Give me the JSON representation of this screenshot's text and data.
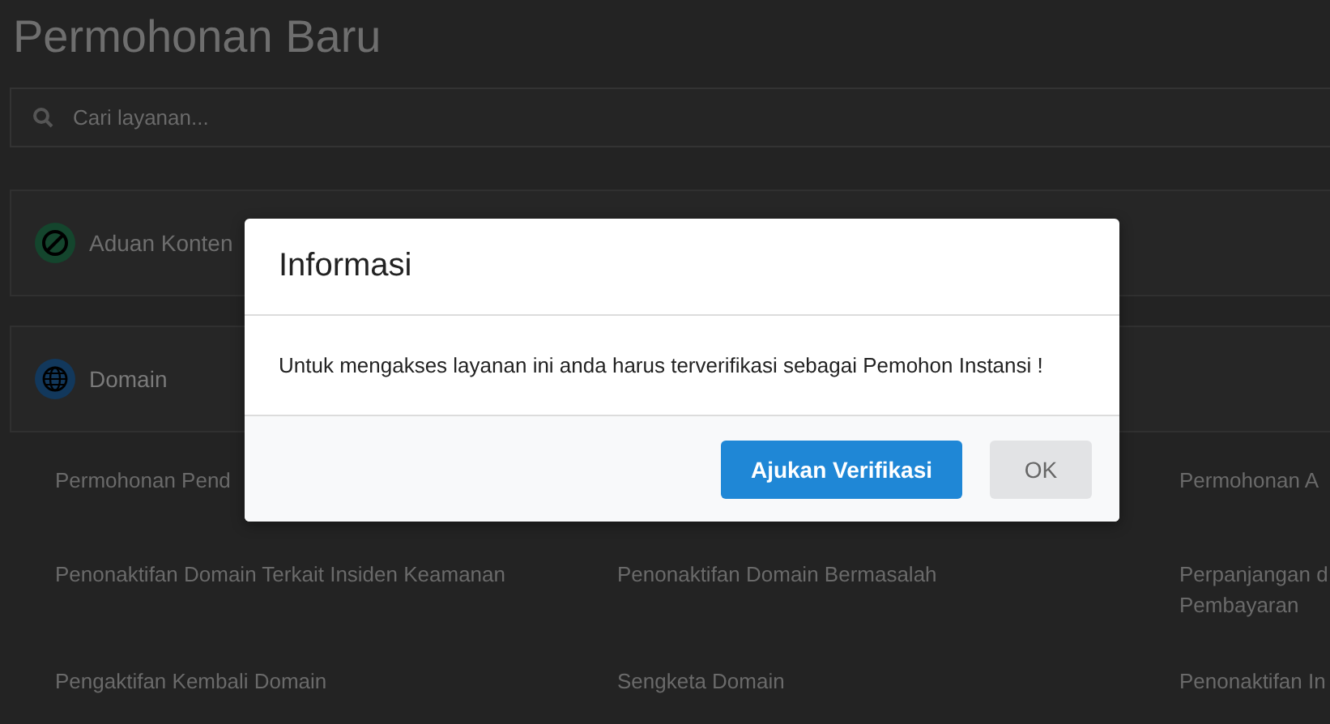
{
  "page": {
    "title": "Permohonan Baru"
  },
  "search": {
    "placeholder": "Cari layanan..."
  },
  "categories": [
    {
      "label": "Aduan Konten",
      "kind": "content"
    },
    {
      "label": "Domain",
      "kind": "domain"
    }
  ],
  "service_rows": [
    {
      "left": "Permohonan Pend",
      "right": "Permohonan A"
    },
    {
      "left": "Penonaktifan Domain Terkait Insiden Keamanan",
      "middle": "Penonaktifan Domain Bermasalah",
      "right": "Perpanjangan d\nPembayaran"
    },
    {
      "left": "Pengaktifan Kembali Domain",
      "middle": "Sengketa Domain",
      "right": "Penonaktifan In"
    }
  ],
  "dialog": {
    "title": "Informasi",
    "message": "Untuk mengakses layanan ini anda harus terverifikasi sebagai Pemohon Instansi !",
    "buttons": [
      {
        "label": "Ajukan Verifikasi",
        "kind": "primary"
      },
      {
        "label": "OK",
        "kind": "secondary"
      }
    ]
  }
}
